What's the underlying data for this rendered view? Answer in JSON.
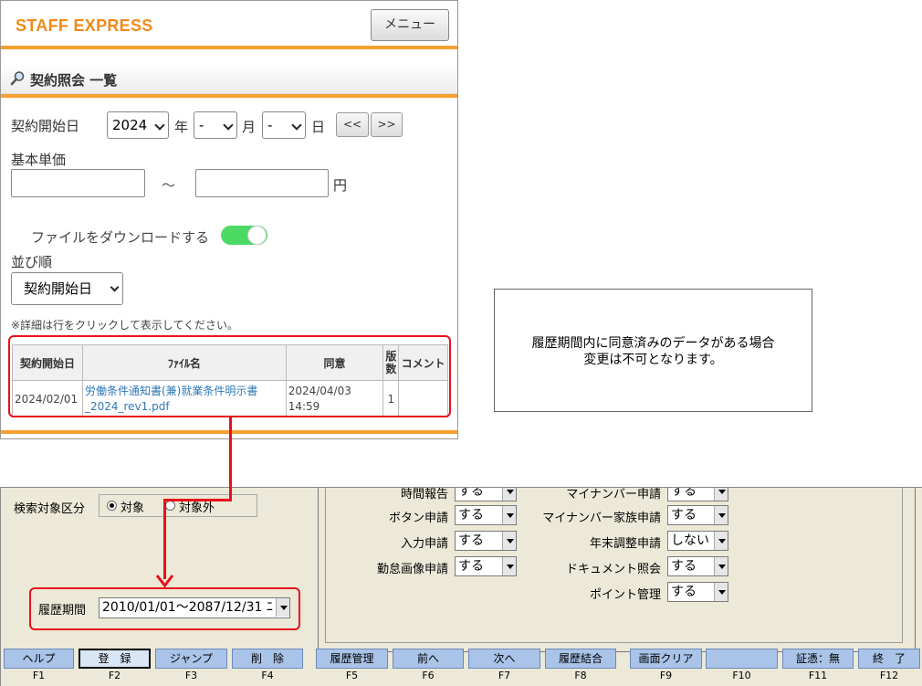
{
  "mobile": {
    "brand": "STAFF EXPRESS",
    "menu_label": "メニュー",
    "page_title": "契約照会 一覧",
    "start_date_label": "契約開始日",
    "year_value": "2024",
    "year_suffix": "年",
    "month_value": "-",
    "month_suffix": "月",
    "day_value": "-",
    "day_suffix": "日",
    "prev_label": "<<",
    "next_label": ">>",
    "base_price_label": "基本単価",
    "range_sep": "～",
    "yen": "円",
    "download_label": "ファイルをダウンロードする",
    "download_on": true,
    "sort_label": "並び順",
    "sort_value": "契約開始日",
    "note": "※詳細は行をクリックして表示してください。",
    "table": {
      "headers": [
        "契約開始日",
        "ﾌｧｲﾙ名",
        "同意",
        "版数",
        "コメント"
      ],
      "rows": [
        {
          "start": "2024/02/01",
          "file": "労働条件通知書(兼)就業条件明示書_2024_rev1.pdf",
          "agree": "2024/04/03 14:59",
          "version": "1",
          "comment": ""
        }
      ]
    }
  },
  "annotation": {
    "line1": "履歴期間内に同意済みのデータがある場合",
    "line2": "変更は不可となります。"
  },
  "desktop": {
    "search_label": "検索対象区分",
    "radio_on": "対象",
    "radio_off": "対象外",
    "left_fields": [
      {
        "label": "時間報告",
        "value": "する"
      },
      {
        "label": "ボタン申請",
        "value": "する"
      },
      {
        "label": "入力申請",
        "value": "する"
      },
      {
        "label": "勤怠画像申請",
        "value": "する"
      }
    ],
    "right_fields": [
      {
        "label": "マイナンバー申請",
        "value": "する"
      },
      {
        "label": "マイナンバー家族申請",
        "value": "する"
      },
      {
        "label": "年末調整申請",
        "value": "しない"
      },
      {
        "label": "ドキュメント照会",
        "value": "する"
      },
      {
        "label": "ポイント管理",
        "value": "する"
      }
    ],
    "period_label": "履歴期間",
    "period_value": "2010/01/01～2087/12/31 ﾆ",
    "fkeys": [
      {
        "label": "ヘルプ",
        "num": "F1"
      },
      {
        "label": "登　録",
        "num": "F2"
      },
      {
        "label": "ジャンプ",
        "num": "F3"
      },
      {
        "label": "削　除",
        "num": "F4"
      },
      {
        "label": "履歴管理",
        "num": "F5"
      },
      {
        "label": "前へ",
        "num": "F6"
      },
      {
        "label": "次へ",
        "num": "F7"
      },
      {
        "label": "履歴結合",
        "num": "F8"
      },
      {
        "label": "画面クリア",
        "num": "F9"
      },
      {
        "label": "",
        "num": "F10"
      },
      {
        "label": "証憑：無",
        "num": "F11"
      },
      {
        "label": "終　了",
        "num": "F12"
      }
    ]
  }
}
